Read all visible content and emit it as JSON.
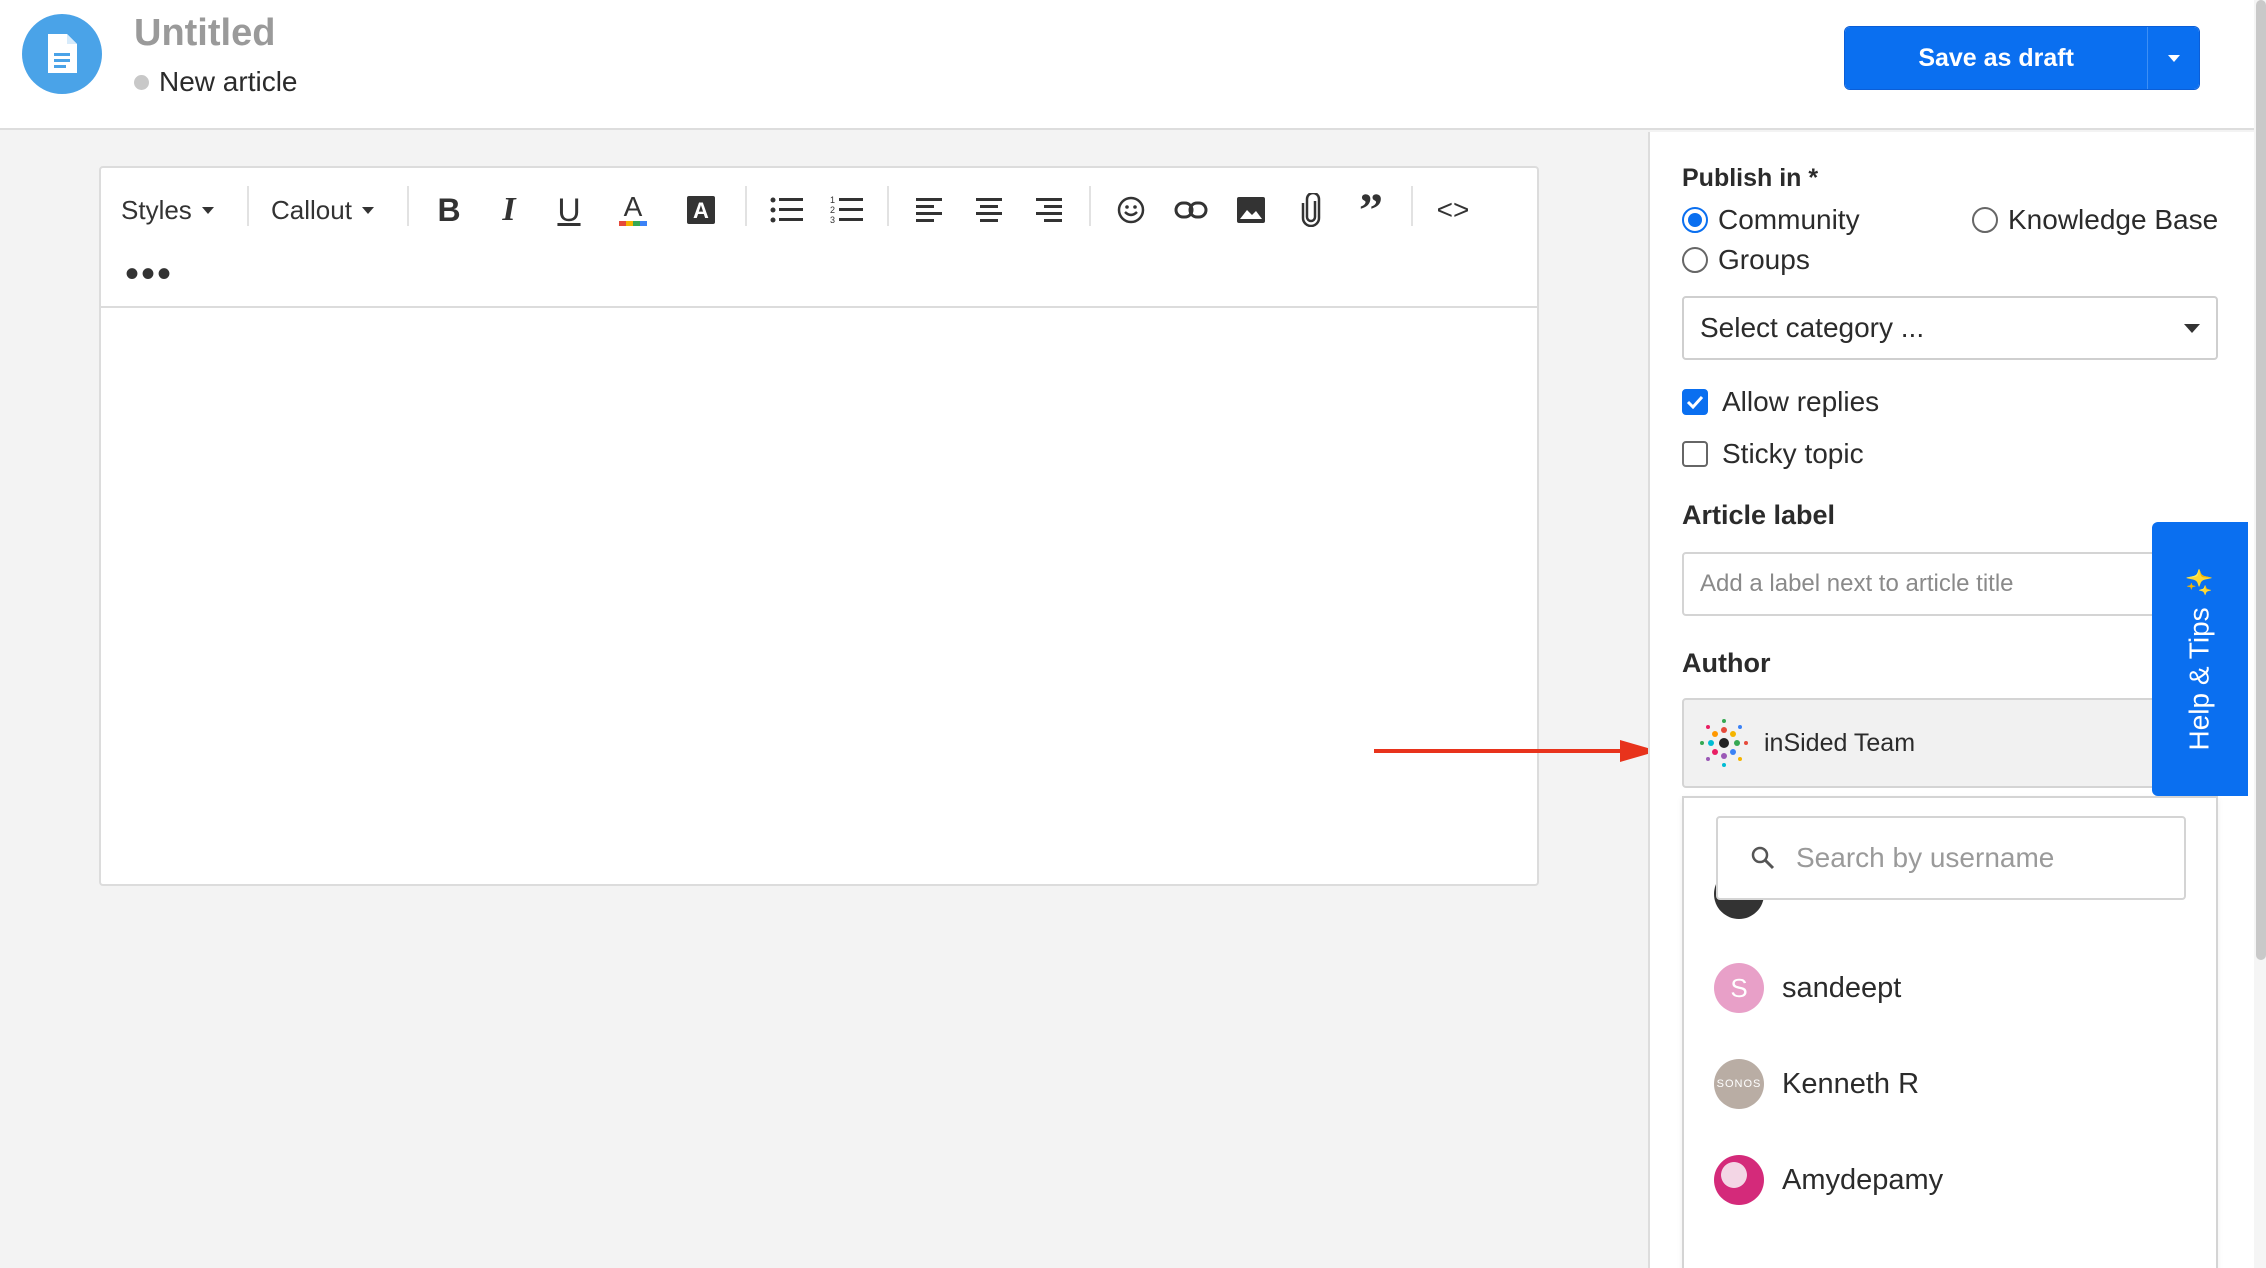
{
  "header": {
    "title": "Untitled",
    "status": "New article",
    "save_label": "Save as draft"
  },
  "toolbar": {
    "styles_label": "Styles",
    "callout_label": "Callout",
    "more_label": "•••"
  },
  "sidebar": {
    "publish_in_label": "Publish in *",
    "publish_options": [
      {
        "label": "Community",
        "selected": true
      },
      {
        "label": "Knowledge Base",
        "selected": false
      },
      {
        "label": "Groups",
        "selected": false
      }
    ],
    "category_select": "Select category ...",
    "allow_replies": {
      "label": "Allow replies",
      "checked": true
    },
    "sticky_topic": {
      "label": "Sticky topic",
      "checked": false
    },
    "article_label_heading": "Article label",
    "article_label_placeholder": "Add a label next to article title",
    "author_heading": "Author",
    "author_selected": "inSided Team",
    "search_placeholder": "Search by username",
    "users": [
      {
        "name": "sandeept",
        "initial": "S",
        "avatar_color": "#e8a0c8"
      },
      {
        "name": "Kenneth R",
        "initial": "SONOS",
        "avatar_color": "#b9ada4"
      },
      {
        "name": "Amydepamy",
        "initial": "",
        "avatar_color": "#d42a7a"
      }
    ]
  },
  "help_tab": {
    "label": "Help & Tips"
  },
  "colors": {
    "primary": "#0a6ff0",
    "doc_icon": "#4aa3e8",
    "annotation_arrow": "#e8331c"
  }
}
